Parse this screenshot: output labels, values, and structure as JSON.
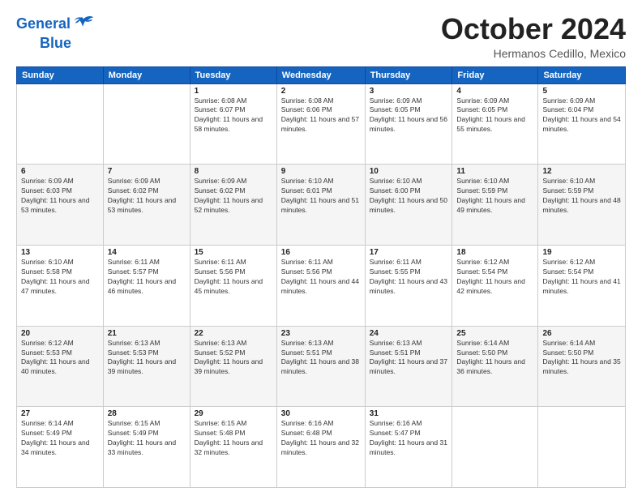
{
  "logo": {
    "line1": "General",
    "line2": "Blue"
  },
  "title": "October 2024",
  "location": "Hermanos Cedillo, Mexico",
  "days_header": [
    "Sunday",
    "Monday",
    "Tuesday",
    "Wednesday",
    "Thursday",
    "Friday",
    "Saturday"
  ],
  "weeks": [
    [
      {
        "num": "",
        "sunrise": "",
        "sunset": "",
        "daylight": ""
      },
      {
        "num": "",
        "sunrise": "",
        "sunset": "",
        "daylight": ""
      },
      {
        "num": "1",
        "sunrise": "Sunrise: 6:08 AM",
        "sunset": "Sunset: 6:07 PM",
        "daylight": "Daylight: 11 hours and 58 minutes."
      },
      {
        "num": "2",
        "sunrise": "Sunrise: 6:08 AM",
        "sunset": "Sunset: 6:06 PM",
        "daylight": "Daylight: 11 hours and 57 minutes."
      },
      {
        "num": "3",
        "sunrise": "Sunrise: 6:09 AM",
        "sunset": "Sunset: 6:05 PM",
        "daylight": "Daylight: 11 hours and 56 minutes."
      },
      {
        "num": "4",
        "sunrise": "Sunrise: 6:09 AM",
        "sunset": "Sunset: 6:05 PM",
        "daylight": "Daylight: 11 hours and 55 minutes."
      },
      {
        "num": "5",
        "sunrise": "Sunrise: 6:09 AM",
        "sunset": "Sunset: 6:04 PM",
        "daylight": "Daylight: 11 hours and 54 minutes."
      }
    ],
    [
      {
        "num": "6",
        "sunrise": "Sunrise: 6:09 AM",
        "sunset": "Sunset: 6:03 PM",
        "daylight": "Daylight: 11 hours and 53 minutes."
      },
      {
        "num": "7",
        "sunrise": "Sunrise: 6:09 AM",
        "sunset": "Sunset: 6:02 PM",
        "daylight": "Daylight: 11 hours and 53 minutes."
      },
      {
        "num": "8",
        "sunrise": "Sunrise: 6:09 AM",
        "sunset": "Sunset: 6:02 PM",
        "daylight": "Daylight: 11 hours and 52 minutes."
      },
      {
        "num": "9",
        "sunrise": "Sunrise: 6:10 AM",
        "sunset": "Sunset: 6:01 PM",
        "daylight": "Daylight: 11 hours and 51 minutes."
      },
      {
        "num": "10",
        "sunrise": "Sunrise: 6:10 AM",
        "sunset": "Sunset: 6:00 PM",
        "daylight": "Daylight: 11 hours and 50 minutes."
      },
      {
        "num": "11",
        "sunrise": "Sunrise: 6:10 AM",
        "sunset": "Sunset: 5:59 PM",
        "daylight": "Daylight: 11 hours and 49 minutes."
      },
      {
        "num": "12",
        "sunrise": "Sunrise: 6:10 AM",
        "sunset": "Sunset: 5:59 PM",
        "daylight": "Daylight: 11 hours and 48 minutes."
      }
    ],
    [
      {
        "num": "13",
        "sunrise": "Sunrise: 6:10 AM",
        "sunset": "Sunset: 5:58 PM",
        "daylight": "Daylight: 11 hours and 47 minutes."
      },
      {
        "num": "14",
        "sunrise": "Sunrise: 6:11 AM",
        "sunset": "Sunset: 5:57 PM",
        "daylight": "Daylight: 11 hours and 46 minutes."
      },
      {
        "num": "15",
        "sunrise": "Sunrise: 6:11 AM",
        "sunset": "Sunset: 5:56 PM",
        "daylight": "Daylight: 11 hours and 45 minutes."
      },
      {
        "num": "16",
        "sunrise": "Sunrise: 6:11 AM",
        "sunset": "Sunset: 5:56 PM",
        "daylight": "Daylight: 11 hours and 44 minutes."
      },
      {
        "num": "17",
        "sunrise": "Sunrise: 6:11 AM",
        "sunset": "Sunset: 5:55 PM",
        "daylight": "Daylight: 11 hours and 43 minutes."
      },
      {
        "num": "18",
        "sunrise": "Sunrise: 6:12 AM",
        "sunset": "Sunset: 5:54 PM",
        "daylight": "Daylight: 11 hours and 42 minutes."
      },
      {
        "num": "19",
        "sunrise": "Sunrise: 6:12 AM",
        "sunset": "Sunset: 5:54 PM",
        "daylight": "Daylight: 11 hours and 41 minutes."
      }
    ],
    [
      {
        "num": "20",
        "sunrise": "Sunrise: 6:12 AM",
        "sunset": "Sunset: 5:53 PM",
        "daylight": "Daylight: 11 hours and 40 minutes."
      },
      {
        "num": "21",
        "sunrise": "Sunrise: 6:13 AM",
        "sunset": "Sunset: 5:53 PM",
        "daylight": "Daylight: 11 hours and 39 minutes."
      },
      {
        "num": "22",
        "sunrise": "Sunrise: 6:13 AM",
        "sunset": "Sunset: 5:52 PM",
        "daylight": "Daylight: 11 hours and 39 minutes."
      },
      {
        "num": "23",
        "sunrise": "Sunrise: 6:13 AM",
        "sunset": "Sunset: 5:51 PM",
        "daylight": "Daylight: 11 hours and 38 minutes."
      },
      {
        "num": "24",
        "sunrise": "Sunrise: 6:13 AM",
        "sunset": "Sunset: 5:51 PM",
        "daylight": "Daylight: 11 hours and 37 minutes."
      },
      {
        "num": "25",
        "sunrise": "Sunrise: 6:14 AM",
        "sunset": "Sunset: 5:50 PM",
        "daylight": "Daylight: 11 hours and 36 minutes."
      },
      {
        "num": "26",
        "sunrise": "Sunrise: 6:14 AM",
        "sunset": "Sunset: 5:50 PM",
        "daylight": "Daylight: 11 hours and 35 minutes."
      }
    ],
    [
      {
        "num": "27",
        "sunrise": "Sunrise: 6:14 AM",
        "sunset": "Sunset: 5:49 PM",
        "daylight": "Daylight: 11 hours and 34 minutes."
      },
      {
        "num": "28",
        "sunrise": "Sunrise: 6:15 AM",
        "sunset": "Sunset: 5:49 PM",
        "daylight": "Daylight: 11 hours and 33 minutes."
      },
      {
        "num": "29",
        "sunrise": "Sunrise: 6:15 AM",
        "sunset": "Sunset: 5:48 PM",
        "daylight": "Daylight: 11 hours and 32 minutes."
      },
      {
        "num": "30",
        "sunrise": "Sunrise: 6:16 AM",
        "sunset": "Sunset: 6:48 PM",
        "daylight": "Daylight: 11 hours and 32 minutes."
      },
      {
        "num": "31",
        "sunrise": "Sunrise: 6:16 AM",
        "sunset": "Sunset: 5:47 PM",
        "daylight": "Daylight: 11 hours and 31 minutes."
      },
      {
        "num": "",
        "sunrise": "",
        "sunset": "",
        "daylight": ""
      },
      {
        "num": "",
        "sunrise": "",
        "sunset": "",
        "daylight": ""
      }
    ]
  ]
}
